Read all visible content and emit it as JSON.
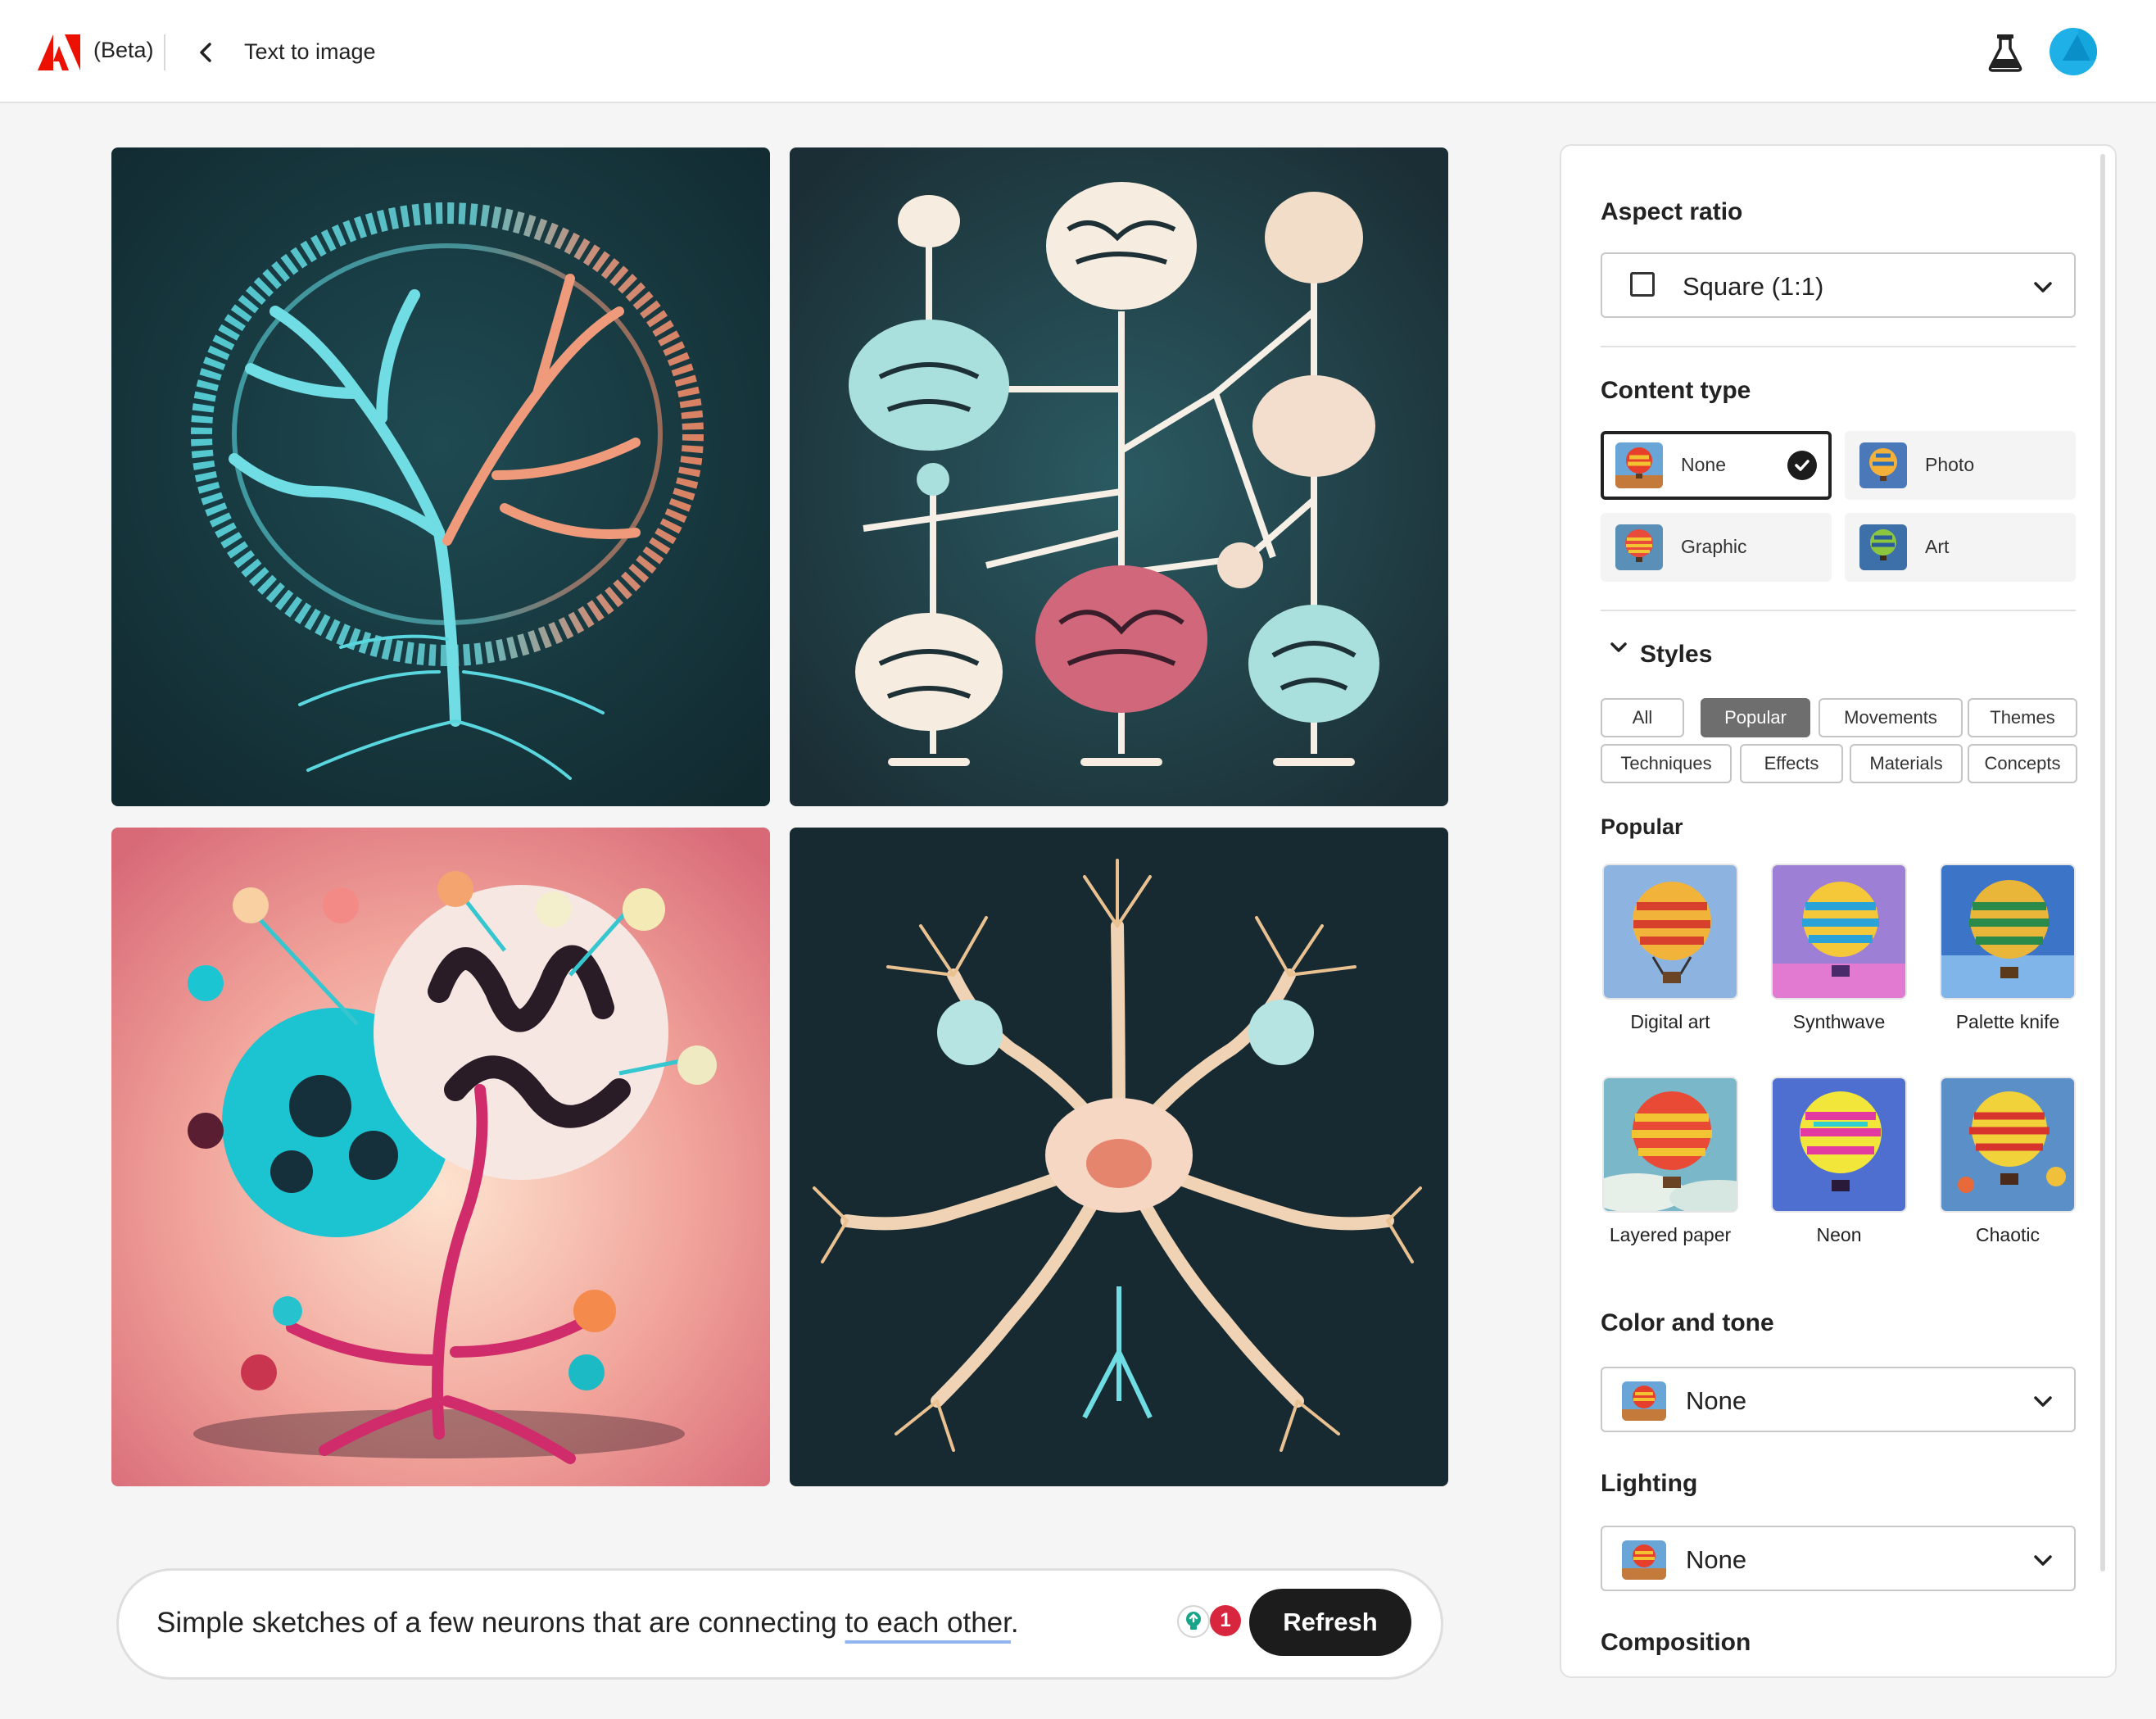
{
  "header": {
    "beta_label": "(Beta)",
    "page_title": "Text to image"
  },
  "prompt": {
    "text_plain": "Simple sketches of a few neurons that are connecting ",
    "text_underlined": "to each other",
    "text_end": ".",
    "credits_count": "1",
    "refresh_label": "Refresh"
  },
  "panel": {
    "aspect_ratio": {
      "title": "Aspect ratio",
      "value": "Square (1:1)"
    },
    "content_type": {
      "title": "Content type",
      "options": [
        {
          "label": "None",
          "selected": true
        },
        {
          "label": "Photo",
          "selected": false
        },
        {
          "label": "Graphic",
          "selected": false
        },
        {
          "label": "Art",
          "selected": false
        }
      ]
    },
    "styles": {
      "title": "Styles",
      "chips": [
        "All",
        "Popular",
        "Movements",
        "Themes",
        "Techniques",
        "Effects",
        "Materials",
        "Concepts"
      ],
      "active_chip": "Popular",
      "popular_title": "Popular",
      "popular_items": [
        "Digital art",
        "Synthwave",
        "Palette knife",
        "Layered paper",
        "Neon",
        "Chaotic"
      ]
    },
    "color_tone": {
      "title": "Color and tone",
      "value": "None"
    },
    "lighting": {
      "title": "Lighting",
      "value": "None"
    },
    "composition": {
      "title": "Composition"
    }
  },
  "colors": {
    "accent_selected": "#222222",
    "refresh_bg": "#1c1c1c",
    "badge": "#d7263d",
    "avatar": "#1fb0e8",
    "adobe_red": "#eb1000"
  }
}
